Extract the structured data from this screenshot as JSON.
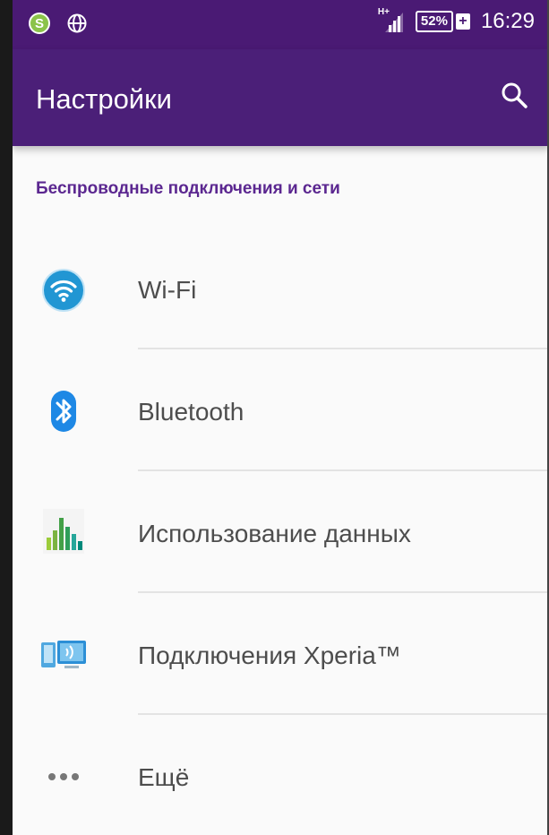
{
  "statusbar": {
    "left_badge_letter": "S",
    "network_type": "H+",
    "battery_level": "52%",
    "battery_charging_symbol": "+",
    "time": "16:29"
  },
  "appbar": {
    "title": "Настройки",
    "search_icon": "search-icon"
  },
  "section": {
    "header": "Беспроводные подключения и сети"
  },
  "items": [
    {
      "label": "Wi-Fi",
      "icon": "wifi-icon"
    },
    {
      "label": "Bluetooth",
      "icon": "bluetooth-icon"
    },
    {
      "label": "Использование данных",
      "icon": "data-usage-icon"
    },
    {
      "label": "Подключения Xperia™",
      "icon": "xperia-connections-icon"
    },
    {
      "label": "Ещё",
      "icon": "more-dots-icon"
    }
  ],
  "colors": {
    "statusbar_bg": "#4a1a74",
    "appbar_bg": "#4b1f78",
    "section_header": "#5b2790",
    "wifi_blue": "#2196d3",
    "bluetooth_blue": "#1e88e5"
  }
}
